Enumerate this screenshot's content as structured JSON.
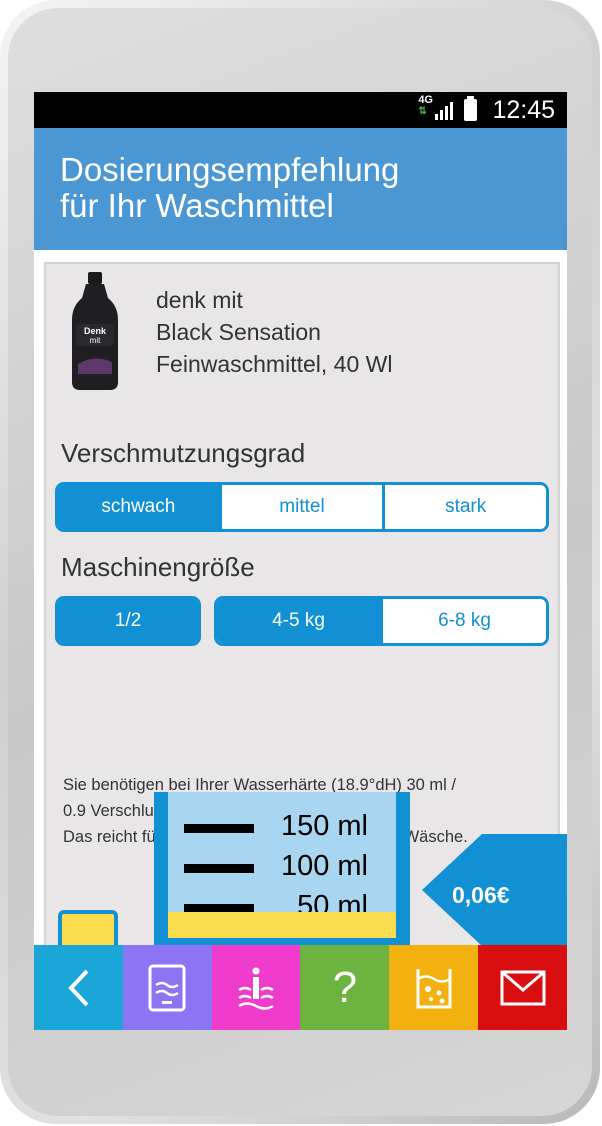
{
  "status": {
    "time": "12:45",
    "network": "4G"
  },
  "header": {
    "title": "Dosierungsempfehlung\nfür Ihr Waschmittel"
  },
  "product": {
    "image_label": "Denk mit",
    "line1": "denk mit",
    "line2": "Black Sensation",
    "line3": "Feinwaschmittel, 40 Wl"
  },
  "soiling": {
    "label": "Verschmutzungsgrad",
    "options": [
      "schwach",
      "mittel",
      "stark"
    ],
    "selected": "schwach"
  },
  "machine": {
    "label": "Maschinengröße",
    "half": "1/2",
    "options": [
      "4-5 kg",
      "6-8 kg"
    ],
    "selected": "4-5 kg"
  },
  "info": {
    "line1": "Sie benötigen bei Ihrer Wasserhärte (18.9°dH) 30 ml /",
    "line2": "0.9 Verschlusskappen Waschmittel.",
    "line3": "Das reicht für 33 Waschladungen à 0.06 € pro Wäsche."
  },
  "beaker": {
    "marks": [
      "150 ml",
      "100 ml",
      "50 ml"
    ],
    "fill_ml": 30
  },
  "price": {
    "label": "0,06€"
  },
  "nav": [
    {
      "name": "back",
      "icon": "chevron-left-icon",
      "color": "#1aa6d6"
    },
    {
      "name": "detergent",
      "icon": "detergent-icon",
      "color": "#8c74f4"
    },
    {
      "name": "water-info",
      "icon": "water-info-icon",
      "color": "#f03ccd"
    },
    {
      "name": "help",
      "icon": "question-icon",
      "color": "#6db33f"
    },
    {
      "name": "dosage",
      "icon": "bubbles-icon",
      "color": "#f2b10f"
    },
    {
      "name": "mail",
      "icon": "mail-icon",
      "color": "#d90e10"
    }
  ],
  "nav_help_glyph": "?",
  "colors": {
    "accent": "#1190d4",
    "header": "#4a97d4",
    "fill": "#fadc4f"
  }
}
